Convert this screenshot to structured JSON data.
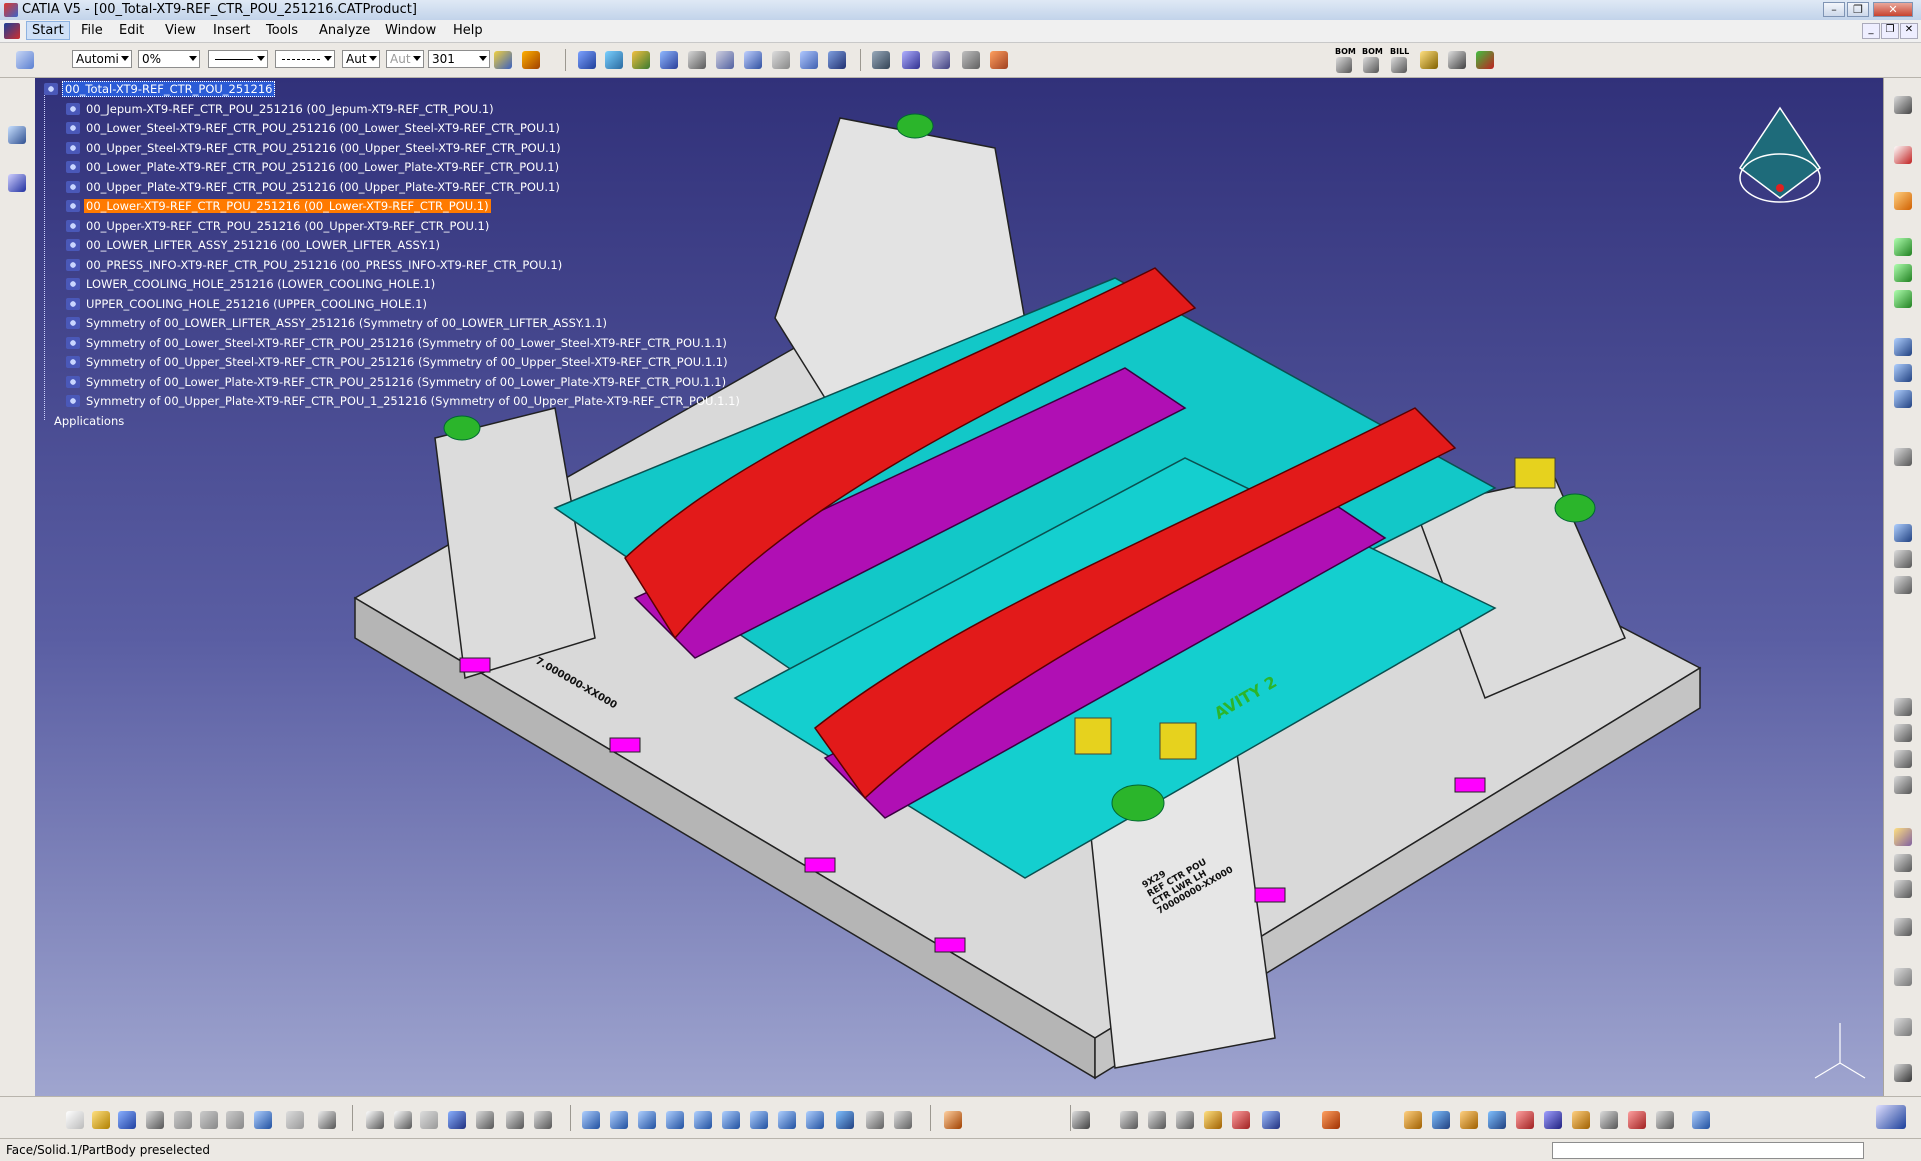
{
  "window": {
    "title": "CATIA V5 - [00_Total-XT9-REF_CTR_POU_251216.CATProduct]",
    "controls": {
      "minimize": "–",
      "maximize": "❐",
      "close": "✕"
    }
  },
  "menubar": {
    "items": [
      "Start",
      "File",
      "Edit",
      "View",
      "Insert",
      "Tools",
      "Analyze",
      "Window",
      "Help"
    ],
    "active": "Start"
  },
  "toolbar": {
    "graphic_mode": "Automi",
    "transparency": "0%",
    "linetype_1": "",
    "linetype_2": "",
    "thickness": "Aut",
    "linestyle": "Aut",
    "layer": "301",
    "bom_labels": [
      "BOM",
      "BOM",
      "BILL"
    ]
  },
  "tree": {
    "root": "00_Total-XT9-REF_CTR_POU_251216",
    "items": [
      "00_Jepum-XT9-REF_CTR_POU_251216 (00_Jepum-XT9-REF_CTR_POU.1)",
      "00_Lower_Steel-XT9-REF_CTR_POU_251216 (00_Lower_Steel-XT9-REF_CTR_POU.1)",
      "00_Upper_Steel-XT9-REF_CTR_POU_251216 (00_Upper_Steel-XT9-REF_CTR_POU.1)",
      "00_Lower_Plate-XT9-REF_CTR_POU_251216 (00_Lower_Plate-XT9-REF_CTR_POU.1)",
      "00_Upper_Plate-XT9-REF_CTR_POU_251216 (00_Upper_Plate-XT9-REF_CTR_POU.1)",
      "00_Lower-XT9-REF_CTR_POU_251216 (00_Lower-XT9-REF_CTR_POU.1)",
      "00_Upper-XT9-REF_CTR_POU_251216 (00_Upper-XT9-REF_CTR_POU.1)",
      "00_LOWER_LIFTER_ASSY_251216 (00_LOWER_LIFTER_ASSY.1)",
      "00_PRESS_INFO-XT9-REF_CTR_POU_251216 (00_PRESS_INFO-XT9-REF_CTR_POU.1)",
      "LOWER_COOLING_HOLE_251216 (LOWER_COOLING_HOLE.1)",
      "UPPER_COOLING_HOLE_251216 (UPPER_COOLING_HOLE.1)",
      "Symmetry of 00_LOWER_LIFTER_ASSY_251216 (Symmetry of 00_LOWER_LIFTER_ASSY.1.1)",
      "Symmetry of 00_Lower_Steel-XT9-REF_CTR_POU_251216 (Symmetry of 00_Lower_Steel-XT9-REF_CTR_POU.1.1)",
      "Symmetry of 00_Upper_Steel-XT9-REF_CTR_POU_251216 (Symmetry of 00_Upper_Steel-XT9-REF_CTR_POU.1.1)",
      "Symmetry of 00_Lower_Plate-XT9-REF_CTR_POU_251216 (Symmetry of 00_Lower_Plate-XT9-REF_CTR_POU.1.1)",
      "Symmetry of 00_Upper_Plate-XT9-REF_CTR_POU_1_251216 (Symmetry of 00_Upper_Plate-XT9-REF_CTR_POU.1.1)"
    ],
    "applications": "Applications",
    "preselected_index": 5
  },
  "model": {
    "cavity_label": "AVITY 2",
    "plate_text_1": "7.000000-XX000",
    "plate_text_2": "9X29\nREF CTR POU\nCTR LWR LH\n70000000-XX000"
  },
  "colors": {
    "part_red": "#e21a1a",
    "cyan": "#12c8c8",
    "magenta": "#b00fb4",
    "grey": "#d8d8d8",
    "yellow": "#e6d21e",
    "green": "#2bb52b",
    "selection_blue": "#2b5bd6",
    "highlight_orange": "#ff7a00"
  },
  "status": {
    "text": "Face/Solid.1/PartBody preselected"
  }
}
